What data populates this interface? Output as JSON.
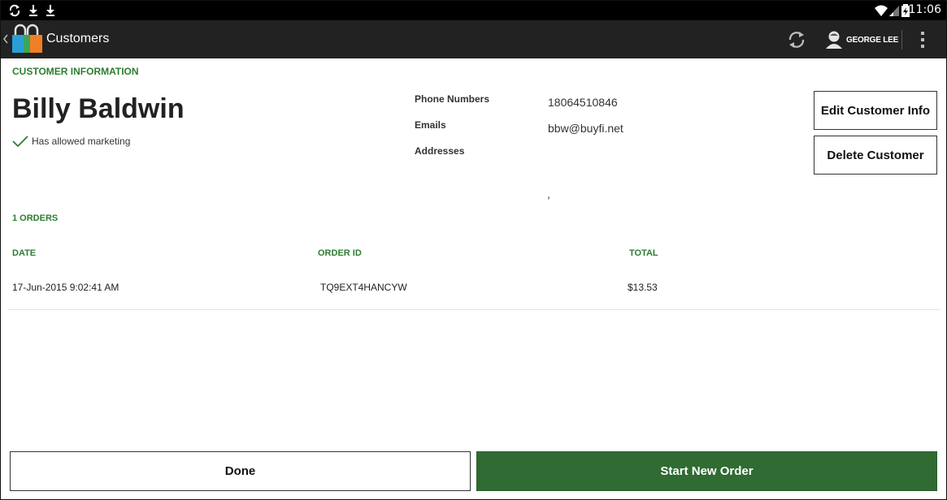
{
  "status_bar": {
    "time": "11:06",
    "icons": [
      "sync-icon",
      "download-icon",
      "download-icon",
      "wifi-icon",
      "signal-icon",
      "battery-icon"
    ]
  },
  "action_bar": {
    "title": "Customers",
    "user_name": "GEORGE LEE",
    "icons": [
      "back-chevron-icon",
      "shopping-bags-logo-icon",
      "refresh-icon",
      "user-icon",
      "overflow-menu-icon"
    ]
  },
  "customer_info": {
    "heading": "CUSTOMER INFORMATION",
    "name": "Billy Baldwin",
    "marketing_label": "Has allowed marketing",
    "phone_label": "Phone Numbers",
    "phone_value": "18064510846",
    "emails_label": "Emails",
    "email_value": "bbw@buyfi.net",
    "addresses_label": "Addresses",
    "address_value": ","
  },
  "actions": {
    "edit_label": "Edit Customer Info",
    "delete_label": "Delete Customer"
  },
  "orders": {
    "heading": "1 ORDERS",
    "columns": [
      "DATE",
      "ORDER ID",
      "TOTAL"
    ],
    "rows": [
      {
        "date": "17-Jun-2015 9:02:41 AM",
        "order_id": "TQ9EXT4HANCYW",
        "total": "$13.53"
      }
    ]
  },
  "footer": {
    "done_label": "Done",
    "start_label": "Start New Order"
  },
  "colors": {
    "accent_green": "#2e7d32",
    "primary_button": "#2f6b33",
    "action_bar": "#222222",
    "status_bar": "#000000"
  }
}
